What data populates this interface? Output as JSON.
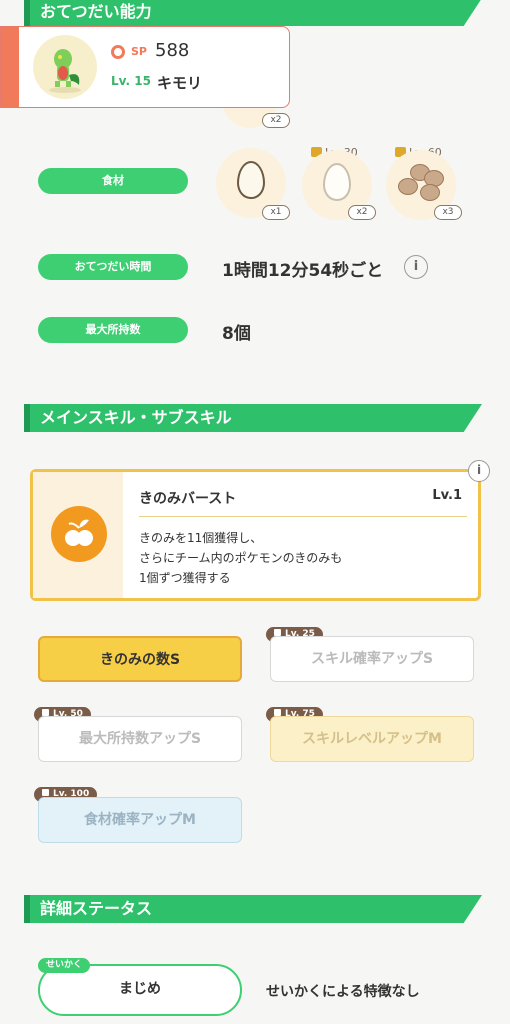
{
  "sections": {
    "help": "おてつだい能力",
    "skills": "メインスキル・サブスキル",
    "details": "詳細ステータス"
  },
  "pokemon": {
    "sp_label": "SP",
    "sp_value": "588",
    "level": "Lv. 15",
    "name": "キモリ"
  },
  "berry_count": "x2",
  "ingredients": {
    "label": "食材",
    "items": [
      {
        "count": "x1",
        "unlock": ""
      },
      {
        "count": "x2",
        "unlock": "Lv. 30"
      },
      {
        "count": "x3",
        "unlock": "Lv. 60"
      }
    ]
  },
  "help_time": {
    "label": "おてつだい時間",
    "value": "1時間12分54秒ごと"
  },
  "max_carry": {
    "label": "最大所持数",
    "value": "8個"
  },
  "main_skill": {
    "name": "きのみバースト",
    "level": "Lv.1",
    "desc_1": "きのみを11個獲得し、",
    "desc_2": "さらにチーム内のポケモンのきのみも",
    "desc_3": "1個ずつ獲得する"
  },
  "sub_skills": [
    {
      "label": "きのみの数S",
      "badge": ""
    },
    {
      "label": "スキル確率アップS",
      "badge": "Lv. 25"
    },
    {
      "label": "最大所持数アップS",
      "badge": "Lv. 50"
    },
    {
      "label": "スキルレベルアップM",
      "badge": "Lv. 75"
    },
    {
      "label": "食材確率アップM",
      "badge": "Lv. 100"
    }
  ],
  "nature": {
    "tag": "せいかく",
    "value": "まじめ",
    "effect": "せいかくによる特徴なし"
  },
  "colors": {
    "accent": "#2fc06b",
    "gold": "#f3c43a",
    "orange": "#f29a1f"
  }
}
